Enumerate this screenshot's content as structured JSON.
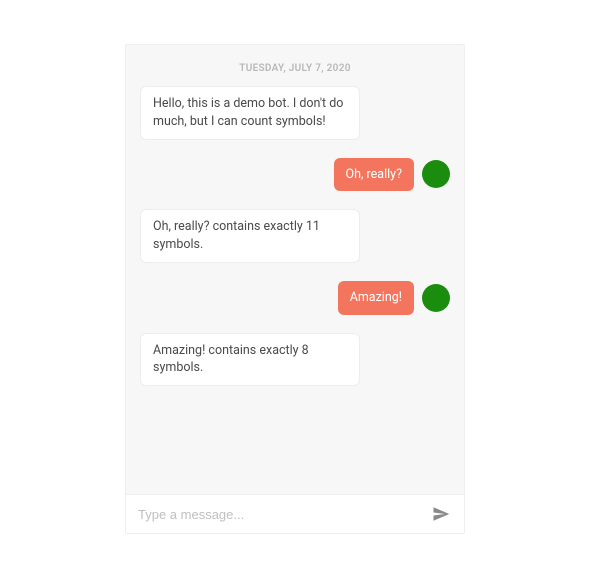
{
  "date_divider": "TUESDAY, JULY 7, 2020",
  "messages": [
    {
      "side": "bot",
      "text": "Hello, this is a demo bot. I don't do much, but I can count symbols!"
    },
    {
      "side": "user",
      "text": "Oh, really?"
    },
    {
      "side": "bot",
      "text": "Oh, really? contains exactly 11 symbols."
    },
    {
      "side": "user",
      "text": "Amazing!"
    },
    {
      "side": "bot",
      "text": "Amazing! contains exactly 8 symbols."
    }
  ],
  "input": {
    "placeholder": "Type a message...",
    "value": ""
  },
  "colors": {
    "user_bubble": "#f4755d",
    "avatar": "#1a8d0e"
  }
}
